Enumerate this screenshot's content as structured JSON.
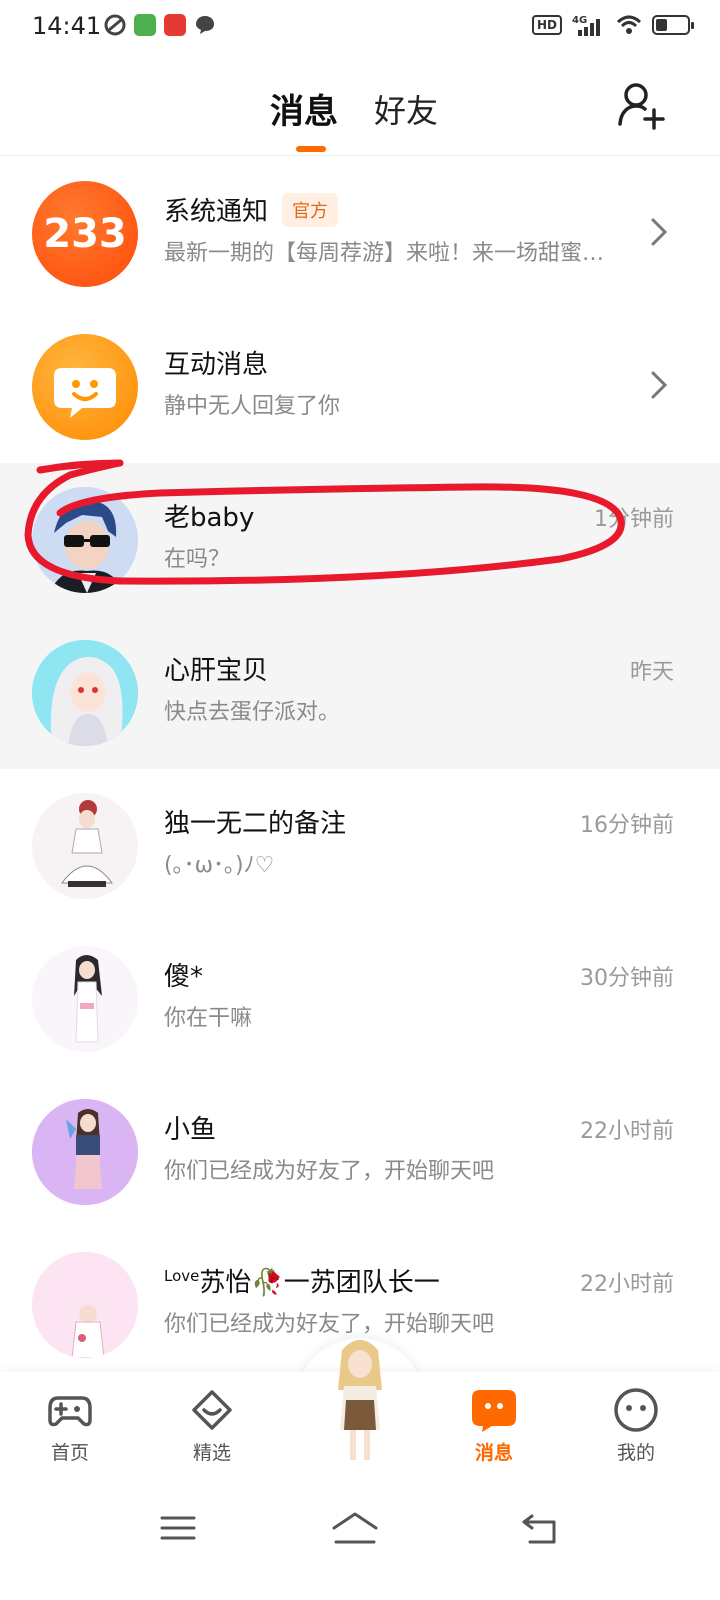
{
  "status_bar": {
    "time": "14:41",
    "hd": "HD",
    "network": "4G",
    "battery_level": 0.35
  },
  "header": {
    "tabs": [
      {
        "label": "消息",
        "active": true
      },
      {
        "label": "好友",
        "active": false
      }
    ],
    "add_friend_icon": "add-person-icon",
    "accent_color": "#ff6a00"
  },
  "conversations": [
    {
      "name": "系统通知",
      "badge": "官方",
      "preview": "最新一期的【每周荐游】来啦！来一场甜蜜…",
      "time": "",
      "icon": "233-logo"
    },
    {
      "name": "互动消息",
      "preview": "静中无人回复了你",
      "time": "",
      "icon": "smile-chat-icon"
    },
    {
      "name": "老baby",
      "preview": "在吗？",
      "time": "1分钟前",
      "highlighted": true
    },
    {
      "name": "心肝宝贝",
      "preview": "快点去蛋仔派对。",
      "time": "昨天",
      "highlighted": true
    },
    {
      "name": "独一无二的备注",
      "preview": "(｡･ω･｡)ﾉ♡",
      "time": "16分钟前"
    },
    {
      "name": "傻*",
      "preview": "你在干嘛",
      "time": "30分钟前"
    },
    {
      "name": "小鱼",
      "preview": "你们已经成为好友了，开始聊天吧",
      "time": "22小时前"
    },
    {
      "name_prefix": "Love",
      "name": "苏怡🥀一苏团队长一",
      "preview": "你们已经成为好友了，开始聊天吧",
      "time": "22小时前"
    }
  ],
  "bottom_nav": [
    {
      "label": "首页",
      "icon": "gamepad-icon"
    },
    {
      "label": "精选",
      "icon": "heart-box-icon"
    },
    {
      "label": "消息",
      "icon": "message-icon",
      "active": true
    },
    {
      "label": "我的",
      "icon": "face-icon"
    }
  ]
}
